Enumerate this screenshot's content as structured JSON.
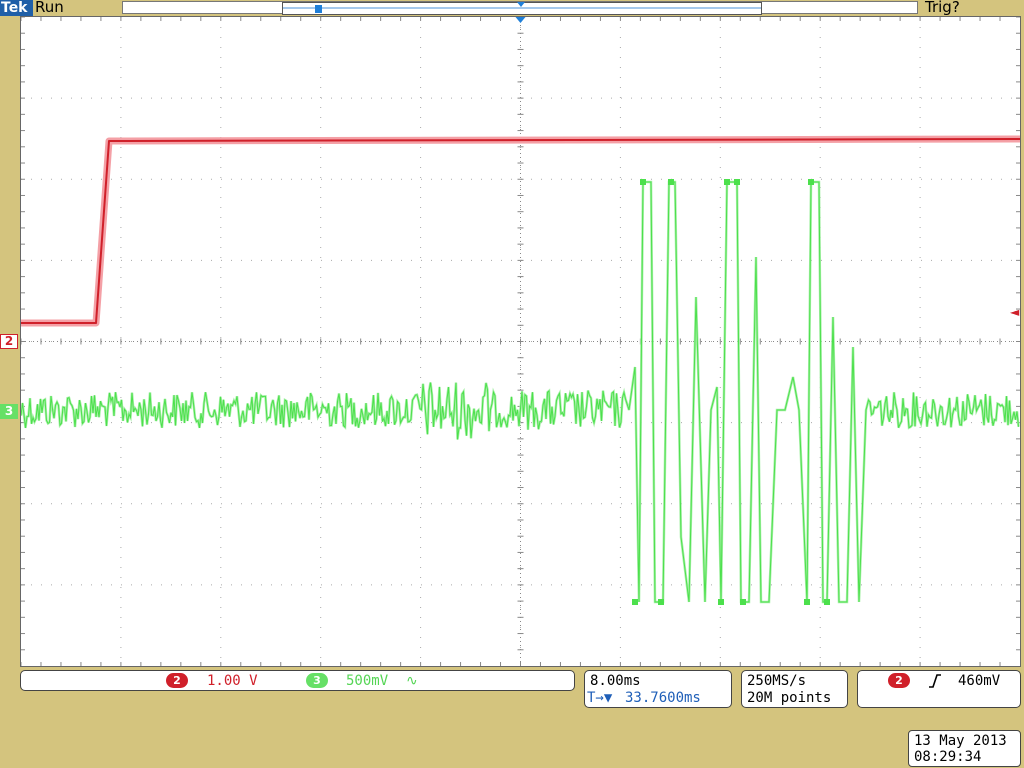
{
  "header": {
    "brand": "Tek",
    "acq_state": "Run",
    "trigger_state": "Trig?",
    "trigger_marker": "T"
  },
  "markers": {
    "ch2": "2",
    "ch3": "3",
    "trigger_level": "◄"
  },
  "channels": {
    "ch2": {
      "number": "2",
      "scale": "1.00 V",
      "color": "#d0202a"
    },
    "ch3": {
      "number": "3",
      "scale": "500mV",
      "coupling_symbol": "∿",
      "color": "#55e055"
    }
  },
  "timebase": {
    "scale": "8.00ms",
    "delay_prefix": "T→▼",
    "delay": "33.7600ms"
  },
  "acquisition": {
    "sample_rate": "250MS/s",
    "record_length": "20M points"
  },
  "trigger": {
    "source": "2",
    "slope_icon": "rising-edge",
    "level": "460mV"
  },
  "datetime": {
    "date": "13 May 2013",
    "time": "08:29:34"
  }
}
